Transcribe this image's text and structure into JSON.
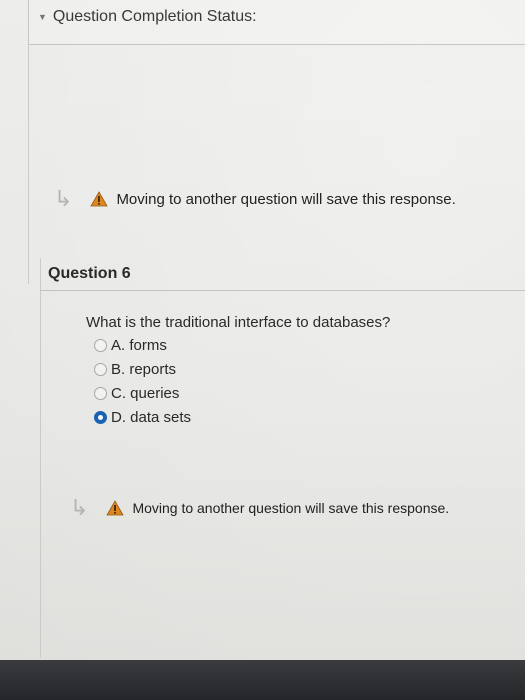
{
  "status": {
    "header": "Question Completion Status:",
    "icon": "caret-down-icon"
  },
  "save_notice_1": {
    "text": "Moving to another question will save this response."
  },
  "question": {
    "title": "Question 6",
    "prompt": "What is the traditional interface to databases?",
    "options": [
      {
        "label": "A. forms",
        "selected": false
      },
      {
        "label": "B. reports",
        "selected": false
      },
      {
        "label": "C. queries",
        "selected": false
      },
      {
        "label": "D. data sets",
        "selected": true
      }
    ]
  },
  "save_notice_2": {
    "text": "Moving to another question will save this response."
  },
  "colors": {
    "accent": "#1b64b7",
    "warning": "#e08a1e"
  }
}
